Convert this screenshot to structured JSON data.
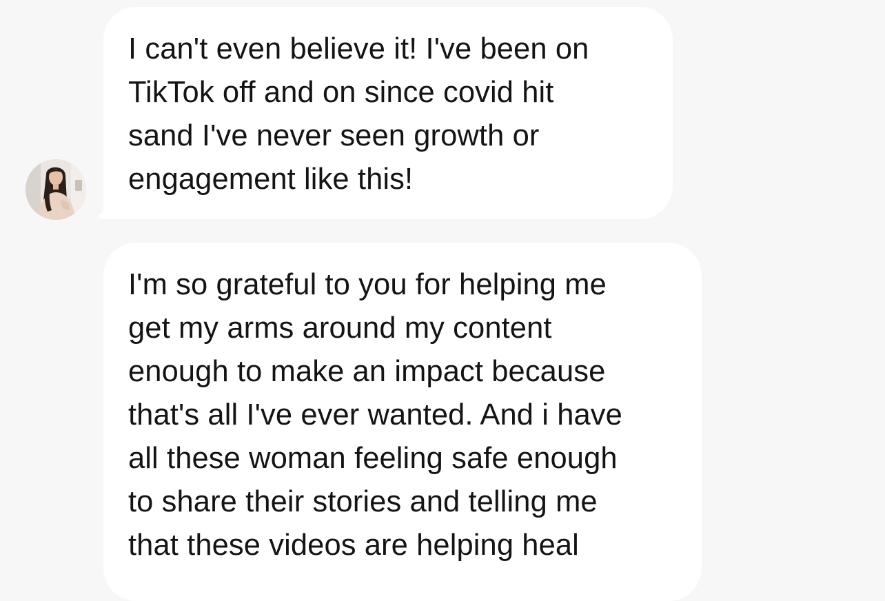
{
  "conversation": {
    "messages": [
      {
        "sender": "contact",
        "text": "I can't even believe it! I've been on\nTikTok off and on since covid hit\nsand I've never seen growth or\nengagement like this!"
      },
      {
        "sender": "contact",
        "text": "I'm so grateful to you for helping me\nget my arms around my content\nenough to make an impact because\nthat's all I've ever wanted. And i have\nall these woman feeling safe enough\nto share their stories and telling me\nthat these videos are helping heal"
      }
    ],
    "avatar_icon": "profile-photo",
    "colors": {
      "background": "#f7f7f7",
      "bubble": "#ffffff",
      "text": "#141414"
    }
  }
}
